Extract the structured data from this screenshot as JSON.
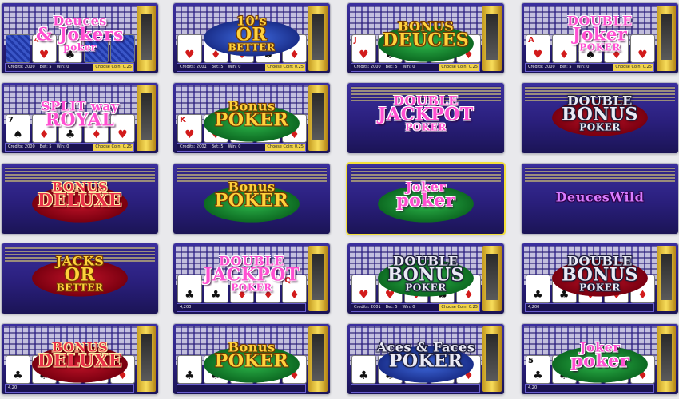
{
  "page": {
    "background": "#e9e9ec",
    "tiles": [
      {
        "row": 0,
        "col": 0,
        "layout": "machine",
        "logo": {
          "lines": [
            "Deuces",
            "& Jokers",
            "poker"
          ],
          "style": "magenta",
          "badge": "none"
        },
        "cards": [
          {
            "rank": "",
            "suit": "",
            "back": true
          },
          {
            "rank": "4",
            "suit": "♥",
            "color": "red"
          },
          {
            "rank": "8",
            "suit": "♣",
            "color": "black"
          },
          {
            "rank": "",
            "suit": "",
            "back": true
          },
          {
            "rank": "",
            "suit": "",
            "back": true
          }
        ],
        "status": {
          "credits": "Credits: 2000",
          "bet": "Bet: 5",
          "win": "Win: 0",
          "coin": "Choose Coin: 0.25"
        }
      },
      {
        "row": 0,
        "col": 1,
        "layout": "machine",
        "logo": {
          "lines": [
            "10's",
            "OR",
            "BETTER"
          ],
          "style": "gold",
          "badge": "blue"
        },
        "cards": [
          {
            "rank": "",
            "suit": "♥",
            "color": "red"
          },
          {
            "rank": "",
            "suit": "♦",
            "color": "red"
          },
          {
            "rank": "",
            "suit": "♦",
            "color": "red"
          },
          {
            "rank": "",
            "suit": "♠",
            "color": "black"
          },
          {
            "rank": "",
            "suit": "♦",
            "color": "red"
          }
        ],
        "status": {
          "credits": "Credits: 2001",
          "bet": "Bet: 5",
          "win": "Win: 0",
          "coin": "Choose Coin: 0.25"
        }
      },
      {
        "row": 0,
        "col": 2,
        "layout": "machine",
        "logo": {
          "lines": [
            "BONUS",
            "DEUCES",
            ""
          ],
          "style": "gold",
          "badge": "green"
        },
        "cards": [
          {
            "rank": "J",
            "suit": "♥",
            "color": "red"
          },
          {
            "rank": "",
            "suit": "♠",
            "color": "black"
          },
          {
            "rank": "",
            "suit": "♣",
            "color": "black"
          },
          {
            "rank": "",
            "suit": "♥",
            "color": "red"
          },
          {
            "rank": "",
            "suit": "♦",
            "color": "red"
          }
        ],
        "status": {
          "credits": "Credits: 2000",
          "bet": "Bet: 5",
          "win": "Win: 0",
          "coin": "Choose Coin: 0.25"
        }
      },
      {
        "row": 0,
        "col": 3,
        "layout": "machine",
        "logo": {
          "lines": [
            "DOUBLE",
            "Joker",
            "POKER"
          ],
          "style": "magenta",
          "badge": "none"
        },
        "cards": [
          {
            "rank": "A",
            "suit": "♥",
            "color": "red"
          },
          {
            "rank": "",
            "suit": "♦",
            "color": "red"
          },
          {
            "rank": "",
            "suit": "♠",
            "color": "black"
          },
          {
            "rank": "",
            "suit": "♦",
            "color": "red"
          },
          {
            "rank": "",
            "suit": "♥",
            "color": "red"
          }
        ],
        "status": {
          "credits": "Credits: 2000",
          "bet": "Bet: 5",
          "win": "Win: 0",
          "coin": "Choose Coin: 0.25"
        }
      },
      {
        "row": 1,
        "col": 0,
        "layout": "machine",
        "logo": {
          "lines": [
            "SPLIT way",
            "ROYAL",
            ""
          ],
          "style": "magenta",
          "badge": "none"
        },
        "cards": [
          {
            "rank": "7",
            "suit": "♠",
            "color": "black"
          },
          {
            "rank": "",
            "suit": "♦",
            "color": "red"
          },
          {
            "rank": "",
            "suit": "♣",
            "color": "black"
          },
          {
            "rank": "",
            "suit": "♦",
            "color": "red"
          },
          {
            "rank": "",
            "suit": "♥",
            "color": "red"
          }
        ],
        "status": {
          "credits": "Credits: 2000",
          "bet": "Bet: 5",
          "win": "Win: 0",
          "coin": "Choose Coin: 0.25"
        }
      },
      {
        "row": 1,
        "col": 1,
        "layout": "machine",
        "logo": {
          "lines": [
            "Bonus",
            "POKER",
            ""
          ],
          "style": "gold",
          "badge": "green"
        },
        "cards": [
          {
            "rank": "K",
            "suit": "♥",
            "color": "red"
          },
          {
            "rank": "",
            "suit": "♥",
            "color": "red"
          },
          {
            "rank": "",
            "suit": "♥",
            "color": "red"
          },
          {
            "rank": "",
            "suit": "♣",
            "color": "black"
          },
          {
            "rank": "",
            "suit": "♦",
            "color": "red"
          }
        ],
        "status": {
          "credits": "Credits: 2002",
          "bet": "Bet: 5",
          "win": "Win: 0",
          "coin": "Choose Coin: 0.25"
        }
      },
      {
        "row": 1,
        "col": 2,
        "layout": "paytable",
        "logo": {
          "lines": [
            "DOUBLE",
            "JACKPOT",
            "POKER"
          ],
          "style": "magenta",
          "badge": "none"
        },
        "cards": [],
        "status": null
      },
      {
        "row": 1,
        "col": 3,
        "layout": "paytable",
        "logo": {
          "lines": [
            "DOUBLE",
            "BONUS",
            "POKER"
          ],
          "style": "silver",
          "badge": "red"
        },
        "cards": [],
        "status": null
      },
      {
        "row": 2,
        "col": 0,
        "layout": "paytable",
        "logo": {
          "lines": [
            "BONUS",
            "DELUXE",
            ""
          ],
          "style": "red",
          "badge": "red"
        },
        "cards": [],
        "status": null
      },
      {
        "row": 2,
        "col": 1,
        "layout": "paytable",
        "logo": {
          "lines": [
            "Bonus",
            "POKER",
            ""
          ],
          "style": "gold",
          "badge": "green"
        },
        "cards": [],
        "status": null
      },
      {
        "row": 2,
        "col": 2,
        "layout": "paytable",
        "highlight": true,
        "logo": {
          "lines": [
            "Joker",
            "poker",
            ""
          ],
          "style": "magenta",
          "badge": "green"
        },
        "cards": [],
        "status": null
      },
      {
        "row": 2,
        "col": 3,
        "layout": "paytable",
        "logo": {
          "lines": [
            "DeucesWild",
            "",
            ""
          ],
          "style": "purple",
          "badge": "none"
        },
        "cards": [],
        "status": null
      },
      {
        "row": 3,
        "col": 0,
        "layout": "paytable",
        "logo": {
          "lines": [
            "JACKS",
            "OR",
            "BETTER"
          ],
          "style": "gold",
          "badge": "red"
        },
        "cards": [],
        "status": null
      },
      {
        "row": 3,
        "col": 1,
        "layout": "machine",
        "logo": {
          "lines": [
            "DOUBLE",
            "JACKPOT",
            "POKER"
          ],
          "style": "magenta",
          "badge": "none"
        },
        "cards": [
          {
            "rank": "",
            "suit": "♣",
            "color": "black"
          },
          {
            "rank": "",
            "suit": "♣",
            "color": "black"
          },
          {
            "rank": "",
            "suit": "♦",
            "color": "red"
          },
          {
            "rank": "",
            "suit": "♦",
            "color": "red"
          },
          {
            "rank": "Q",
            "suit": "♦",
            "color": "red"
          }
        ],
        "status": {
          "credits": "4,200",
          "bet": "",
          "win": "",
          "coin": ""
        }
      },
      {
        "row": 3,
        "col": 2,
        "layout": "machine",
        "logo": {
          "lines": [
            "DOUBLE",
            "BONUS",
            "POKER"
          ],
          "style": "silver",
          "badge": "green"
        },
        "cards": [
          {
            "rank": "",
            "suit": "♥",
            "color": "red"
          },
          {
            "rank": "",
            "suit": "♥",
            "color": "red"
          },
          {
            "rank": "",
            "suit": "♦",
            "color": "red"
          },
          {
            "rank": "",
            "suit": "♣",
            "color": "black"
          },
          {
            "rank": "",
            "suit": "♦",
            "color": "red"
          }
        ],
        "status": {
          "credits": "Credits: 2001",
          "bet": "Bet: 5",
          "win": "Win: 0",
          "coin": "Choose Coin: 0.25"
        }
      },
      {
        "row": 3,
        "col": 3,
        "layout": "machine",
        "logo": {
          "lines": [
            "DOUBLE",
            "BONUS",
            "POKER"
          ],
          "style": "silver",
          "badge": "red"
        },
        "cards": [
          {
            "rank": "",
            "suit": "♣",
            "color": "black"
          },
          {
            "rank": "",
            "suit": "♣",
            "color": "black"
          },
          {
            "rank": "",
            "suit": "♦",
            "color": "red"
          },
          {
            "rank": "",
            "suit": "♦",
            "color": "red"
          },
          {
            "rank": "",
            "suit": "♦",
            "color": "red"
          }
        ],
        "status": {
          "credits": "4,200",
          "bet": "",
          "win": "",
          "coin": ""
        }
      },
      {
        "row": 4,
        "col": 0,
        "layout": "machine",
        "logo": {
          "lines": [
            "BONUS",
            "DELUXE",
            ""
          ],
          "style": "red",
          "badge": "red"
        },
        "cards": [
          {
            "rank": "",
            "suit": "♣",
            "color": "black"
          },
          {
            "rank": "",
            "suit": "♣",
            "color": "black"
          },
          {
            "rank": "",
            "suit": "♦",
            "color": "red"
          },
          {
            "rank": "Q",
            "suit": "♦",
            "color": "red"
          },
          {
            "rank": "",
            "suit": "♦",
            "color": "red"
          }
        ],
        "status": {
          "credits": "4,20",
          "bet": "",
          "win": "",
          "coin": ""
        }
      },
      {
        "row": 4,
        "col": 1,
        "layout": "machine",
        "logo": {
          "lines": [
            "Bonus",
            "POKER",
            ""
          ],
          "style": "gold",
          "badge": "green"
        },
        "cards": [
          {
            "rank": "",
            "suit": "♣",
            "color": "black"
          },
          {
            "rank": "",
            "suit": "♣",
            "color": "black"
          },
          {
            "rank": "",
            "suit": "♦",
            "color": "red"
          },
          {
            "rank": "",
            "suit": "♦",
            "color": "red"
          },
          {
            "rank": "",
            "suit": "♦",
            "color": "red"
          }
        ],
        "status": {
          "credits": "",
          "bet": "",
          "win": "",
          "coin": ""
        }
      },
      {
        "row": 4,
        "col": 2,
        "layout": "machine",
        "logo": {
          "lines": [
            "Aces & Faces",
            "POKER",
            ""
          ],
          "style": "silver",
          "badge": "blue"
        },
        "cards": [
          {
            "rank": "",
            "suit": "♣",
            "color": "black"
          },
          {
            "rank": "",
            "suit": "♣",
            "color": "black"
          },
          {
            "rank": "",
            "suit": "♦",
            "color": "red"
          },
          {
            "rank": "",
            "suit": "♦",
            "color": "red"
          },
          {
            "rank": "",
            "suit": "♦",
            "color": "red"
          }
        ],
        "status": {
          "credits": "",
          "bet": "",
          "win": "",
          "coin": ""
        }
      },
      {
        "row": 4,
        "col": 3,
        "layout": "machine",
        "logo": {
          "lines": [
            "Joker",
            "poker",
            ""
          ],
          "style": "magenta",
          "badge": "green"
        },
        "cards": [
          {
            "rank": "5",
            "suit": "♣",
            "color": "black"
          },
          {
            "rank": "",
            "suit": "♣",
            "color": "black"
          },
          {
            "rank": "",
            "suit": "♦",
            "color": "red"
          },
          {
            "rank": "",
            "suit": "♦",
            "color": "red"
          },
          {
            "rank": "",
            "suit": "♦",
            "color": "red"
          }
        ],
        "status": {
          "credits": "4,20",
          "bet": "",
          "win": "",
          "coin": ""
        }
      }
    ]
  }
}
